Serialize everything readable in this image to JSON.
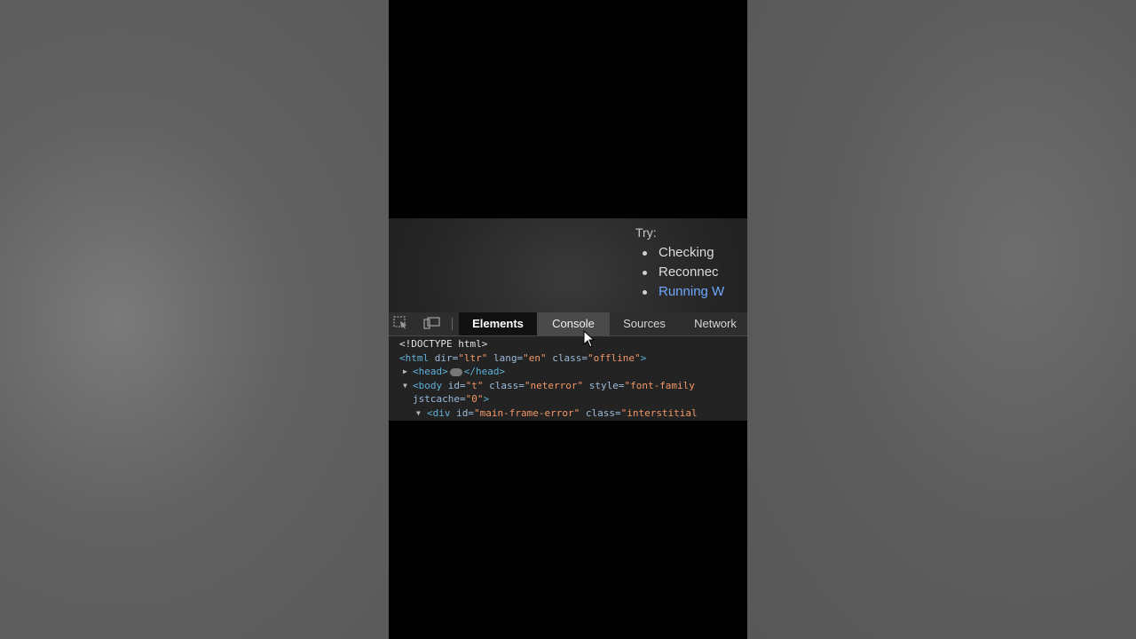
{
  "page": {
    "try_label": "Try:",
    "bullets": [
      "Checking",
      "Reconnec",
      "Running W"
    ]
  },
  "devtools": {
    "tabs": [
      "Elements",
      "Console",
      "Sources",
      "Network"
    ],
    "active_tab": "Elements",
    "hovered_tab": "Console",
    "code": {
      "doctype": "<!DOCTYPE html>",
      "html_open": "<html",
      "html_dir_attr": " dir=",
      "html_dir_val": "\"ltr\"",
      "html_lang_attr": " lang=",
      "html_lang_val": "\"en\"",
      "html_class_attr": " class=",
      "html_class_val": "\"offline\"",
      "html_close": ">",
      "head_open": "<head>",
      "head_close": "</head>",
      "body_open": "<body",
      "body_id_attr": " id=",
      "body_id_val": "\"t\"",
      "body_class_attr": " class=",
      "body_class_val": "\"neterror\"",
      "body_style_attr": " style=",
      "body_style_val": "\"font-family",
      "jstcache_attr": "jstcache=",
      "jstcache_val": "\"0\"",
      "jstcache_close": ">",
      "div_open": "<div",
      "div_id_attr": " id=",
      "div_id_val": "\"main-frame-error\"",
      "div_class_attr": " class=",
      "div_class_val": "\"interstitial"
    }
  }
}
